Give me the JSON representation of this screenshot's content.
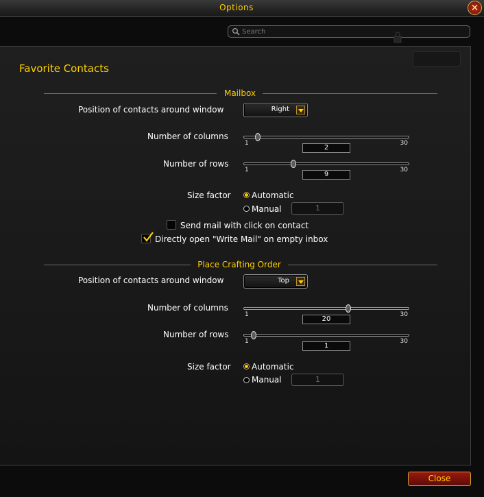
{
  "window": {
    "title": "Options",
    "close_icon": "close-x-icon"
  },
  "search": {
    "placeholder": "Search",
    "value": ""
  },
  "page": {
    "title": "Favorite Contacts"
  },
  "mailbox": {
    "section_title": "Mailbox",
    "position_label": "Position of contacts around window",
    "position_value": "Right",
    "columns": {
      "label": "Number of columns",
      "min": "1",
      "max": "30",
      "value": "2"
    },
    "rows": {
      "label": "Number of rows",
      "min": "1",
      "max": "30",
      "value": "9"
    },
    "size_factor": {
      "label": "Size factor",
      "automatic": "Automatic",
      "manual": "Manual",
      "manual_value": "1",
      "selected": "automatic"
    },
    "send_mail_label": "Send mail with click on contact",
    "send_mail_checked": false,
    "write_mail_label": "Directly open \"Write Mail\" on empty inbox",
    "write_mail_checked": true
  },
  "crafting": {
    "section_title": "Place Crafting Order",
    "position_label": "Position of contacts around window",
    "position_value": "Top",
    "columns": {
      "label": "Number of columns",
      "min": "1",
      "max": "30",
      "value": "20"
    },
    "rows": {
      "label": "Number of rows",
      "min": "1",
      "max": "30",
      "value": "1"
    },
    "size_factor": {
      "label": "Size factor",
      "automatic": "Automatic",
      "manual": "Manual",
      "manual_value": "1",
      "selected": "automatic"
    }
  },
  "footer": {
    "close_label": "Close"
  },
  "colors": {
    "accent": "#ffd100",
    "close_button": "#8a140c"
  }
}
